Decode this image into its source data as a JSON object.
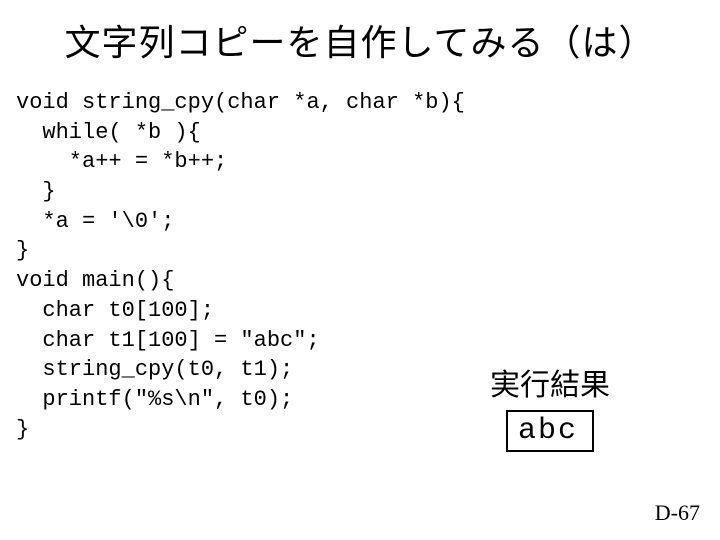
{
  "title": "文字列コピーを自作してみる（は）",
  "code": "void string_cpy(char *a, char *b){\n  while( *b ){\n    *a++ = *b++;\n  }\n  *a = '\\0';\n}\nvoid main(){\n  char t0[100];\n  char t1[100] = \"abc\";\n  string_cpy(t0, t1);\n  printf(\"%s\\n\", t0);\n}",
  "result": {
    "label": "実行結果",
    "output": "abc"
  },
  "page_number": "D-67"
}
